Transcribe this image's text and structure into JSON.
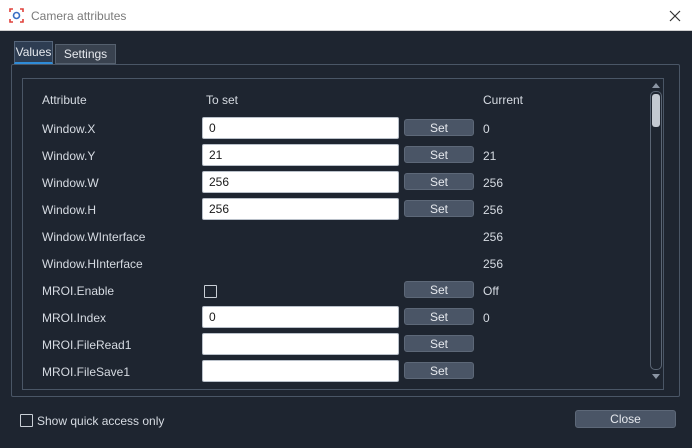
{
  "window": {
    "title": "Camera attributes",
    "accent_color": "#2f8cd8",
    "icon": "camera-app-icon"
  },
  "tabs": [
    {
      "label": "Values",
      "active": true
    },
    {
      "label": "Settings",
      "active": false
    }
  ],
  "table": {
    "headers": {
      "attribute": "Attribute",
      "to_set": "To set",
      "current": "Current"
    },
    "set_label": "Set",
    "rows": [
      {
        "attribute": "Window.X",
        "kind": "input",
        "value": "0",
        "current": "0"
      },
      {
        "attribute": "Window.Y",
        "kind": "input",
        "value": "21",
        "current": "21"
      },
      {
        "attribute": "Window.W",
        "kind": "input",
        "value": "256",
        "current": "256"
      },
      {
        "attribute": "Window.H",
        "kind": "input",
        "value": "256",
        "current": "256"
      },
      {
        "attribute": "Window.WInterface",
        "kind": "none",
        "value": "",
        "current": "256"
      },
      {
        "attribute": "Window.HInterface",
        "kind": "none",
        "value": "",
        "current": "256"
      },
      {
        "attribute": "MROI.Enable",
        "kind": "checkbox",
        "value": "",
        "current": "Off"
      },
      {
        "attribute": "MROI.Index",
        "kind": "input",
        "value": "0",
        "current": "0"
      },
      {
        "attribute": "MROI.FileRead1",
        "kind": "input",
        "value": "",
        "current": ""
      },
      {
        "attribute": "MROI.FileSave1",
        "kind": "input",
        "value": "",
        "current": ""
      }
    ]
  },
  "footer": {
    "quick_access_label": "Show quick access only",
    "close_label": "Close"
  }
}
